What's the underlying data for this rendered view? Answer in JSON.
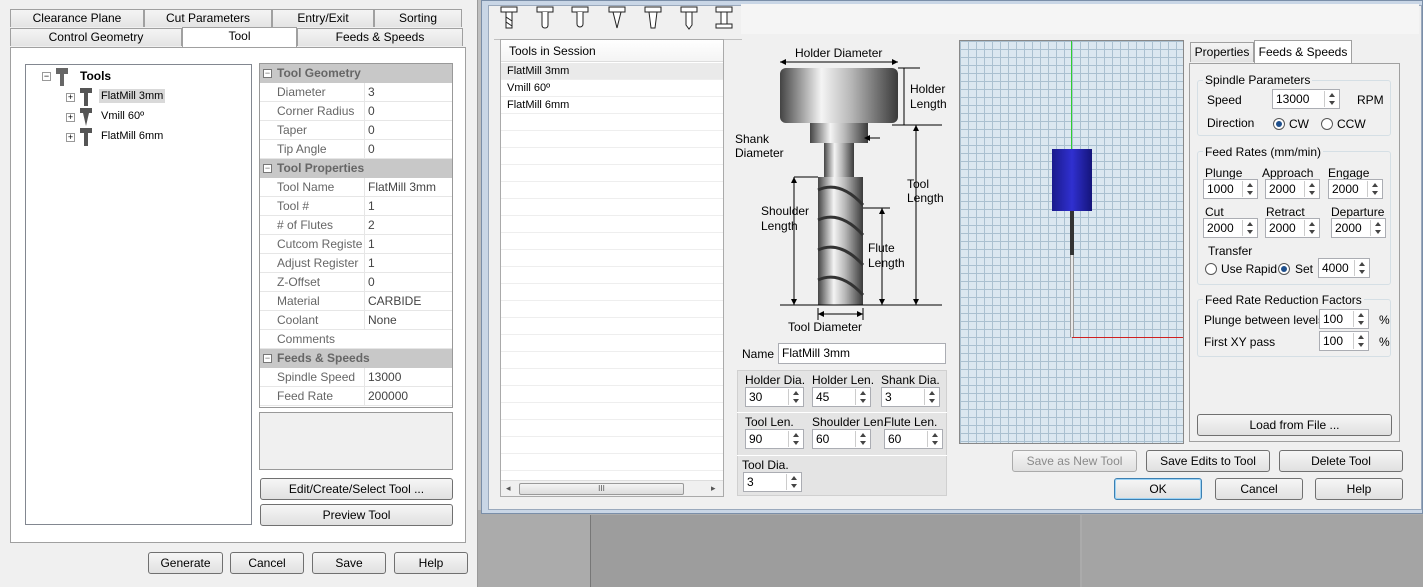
{
  "left": {
    "tabs_top": [
      "Clearance Plane",
      "Cut Parameters",
      "Entry/Exit",
      "Sorting"
    ],
    "tabs_bottom": [
      "Control Geometry",
      "Tool",
      "Feeds & Speeds"
    ],
    "tree_root": "Tools",
    "tree_items": [
      "FlatMill 3mm",
      "Vmill 60º",
      "FlatMill 6mm"
    ],
    "cat_geometry": "Tool Geometry",
    "geometry": [
      {
        "k": "Diameter",
        "v": "3"
      },
      {
        "k": "Corner Radius",
        "v": "0"
      },
      {
        "k": "Taper",
        "v": "0"
      },
      {
        "k": "Tip Angle",
        "v": "0"
      }
    ],
    "cat_properties": "Tool Properties",
    "properties": [
      {
        "k": "Tool Name",
        "v": "FlatMill 3mm"
      },
      {
        "k": "Tool #",
        "v": "1"
      },
      {
        "k": "# of Flutes",
        "v": "2"
      },
      {
        "k": "Cutcom Registe",
        "v": "1"
      },
      {
        "k": "Adjust Register",
        "v": "1"
      },
      {
        "k": "Z-Offset",
        "v": "0"
      },
      {
        "k": "Material",
        "v": " CARBIDE"
      },
      {
        "k": "Coolant",
        "v": "None"
      },
      {
        "k": "Comments",
        "v": ""
      }
    ],
    "cat_feeds": "Feeds & Speeds",
    "feeds": [
      {
        "k": "Spindle Speed",
        "v": "13000"
      },
      {
        "k": "Feed Rate",
        "v": "200000"
      }
    ],
    "edit_btn": "Edit/Create/Select Tool ...",
    "preview_btn": "Preview Tool",
    "generate": "Generate",
    "cancel": "Cancel",
    "save": "Save",
    "help": "Help"
  },
  "dialog": {
    "list_header": "Tools in Session",
    "list_items": [
      "FlatMill 3mm",
      "Vmill 60º",
      "FlatMill 6mm"
    ],
    "scroll_thumb": "III",
    "diagram": {
      "holder_diameter": "Holder Diameter",
      "holder_length_1": "Holder",
      "holder_length_2": "Length",
      "shank_1": "Shank",
      "shank_2": "Diameter",
      "tool_length_1": "Tool",
      "tool_length_2": "Length",
      "shoulder_1": "Shoulder",
      "shoulder_2": "Length",
      "flute_1": "Flute",
      "flute_2": "Length",
      "tool_diameter": "Tool Diameter"
    },
    "name_label": "Name",
    "name_value": "FlatMill 3mm",
    "fields": [
      {
        "label": "Holder Dia.",
        "value": "30"
      },
      {
        "label": "Holder Len.",
        "value": "45"
      },
      {
        "label": "Shank Dia.",
        "value": "3"
      },
      {
        "label": "Tool Len.",
        "value": "90"
      },
      {
        "label": "Shoulder Len.",
        "value": "60"
      },
      {
        "label": "Flute Len.",
        "value": "60"
      },
      {
        "label": "Tool Dia.",
        "value": "3"
      }
    ],
    "tabs": [
      "Properties",
      "Feeds & Speeds"
    ],
    "spindle_group": "Spindle Parameters",
    "speed_label": "Speed",
    "speed_value": "13000",
    "speed_unit": "RPM",
    "direction_label": "Direction",
    "cw": "CW",
    "ccw": "CCW",
    "feed_group": "Feed Rates (mm/min)",
    "feed_fields": [
      {
        "label": "Plunge",
        "value": "1000"
      },
      {
        "label": "Approach",
        "value": "2000"
      },
      {
        "label": "Engage",
        "value": "2000"
      },
      {
        "label": "Cut",
        "value": "2000"
      },
      {
        "label": "Retract",
        "value": "2000"
      },
      {
        "label": "Departure",
        "value": "2000"
      }
    ],
    "transfer_label": "Transfer",
    "use_rapid": "Use Rapid",
    "set": "Set",
    "transfer_value": "4000",
    "reduction_group": "Feed Rate Reduction Factors",
    "plunge_levels": "Plunge between levels",
    "plunge_levels_value": "100",
    "first_xy": "First XY pass",
    "first_xy_value": "100",
    "pct": "%",
    "load_btn": "Load from File ...",
    "save_new": "Save as New Tool",
    "save_edits": "Save Edits to Tool",
    "delete": "Delete Tool",
    "ok": "OK",
    "cancel": "Cancel",
    "help": "Help"
  }
}
